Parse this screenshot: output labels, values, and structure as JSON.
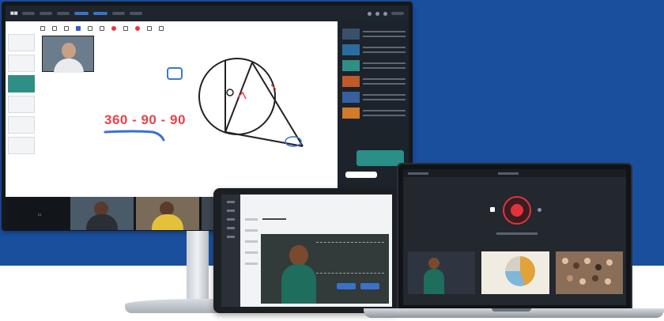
{
  "whiteboard": {
    "math_expression": "360 - 90 - 90"
  },
  "devices": {
    "monitor": "whiteboard-session",
    "tablet": "video-lesson",
    "laptop": "recording-studio"
  },
  "icons": [
    "record-icon",
    "stop-icon",
    "pause-icon",
    "stamp-icon"
  ],
  "colors": {
    "brand_blue": "#1a4f9e",
    "accent_red": "#e8434a",
    "teal": "#2f8f86",
    "record_red": "#e2333c"
  }
}
